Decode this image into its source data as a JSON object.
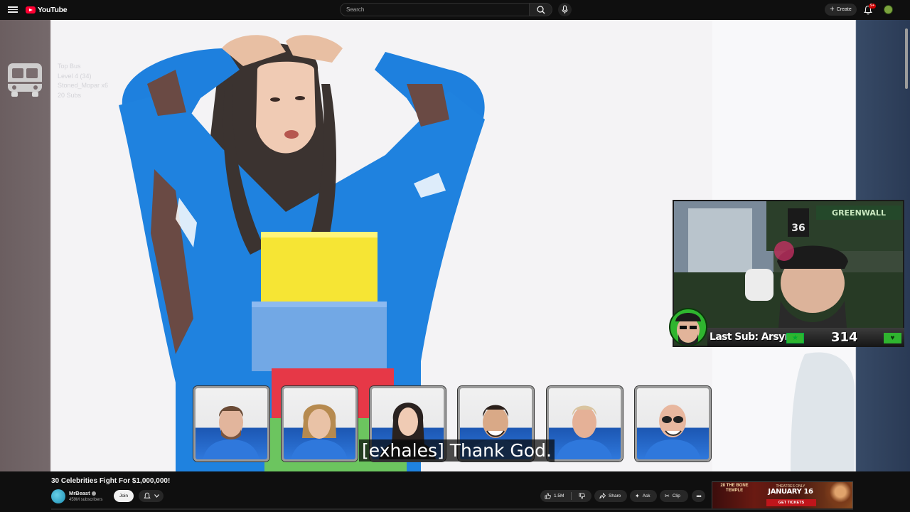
{
  "app": {
    "logo_text": "YouTube"
  },
  "search": {
    "placeholder": "Search"
  },
  "header": {
    "create_label": "Create",
    "notifications_count": "9+"
  },
  "overlay": {
    "bus_lines": [
      "Top Bus",
      "Level 4  (34)",
      "Stoned_Mopar x6",
      "20 Subs"
    ],
    "subtitle": "[exhales] Thank God.",
    "webcam_label": "Last Sub: Arsynn",
    "webcam_count": "314",
    "webcam_sign": "GREENWALL",
    "webcam_jersey": "36"
  },
  "video": {
    "title": "30 Celebrities Fight For $1,000,000!",
    "channel": "MrBeast",
    "subscribers": "459M subscribers",
    "join_label": "Join",
    "likes": "1.5M",
    "share_label": "Share",
    "ask_label": "Ask",
    "clip_label": "Clip"
  },
  "ad": {
    "left_text": "28 THE BONE TEMPLE",
    "top_text": "THEATRES ONLY",
    "date": "JANUARY 16",
    "cta": "GET TICKETS"
  },
  "colors": {
    "brand_red": "#ff0033",
    "jersey_blue": "#2a78dc",
    "stream_green": "#2fb52f"
  }
}
